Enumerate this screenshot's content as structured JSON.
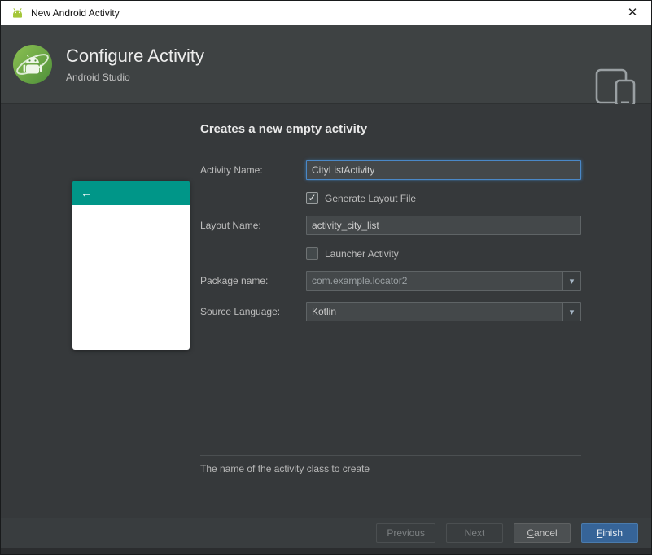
{
  "window": {
    "title": "New Android Activity"
  },
  "icons": {
    "close": "✕",
    "back_arrow": "←",
    "dropdown_arrow": "▾",
    "check": "✓"
  },
  "header": {
    "title": "Configure Activity",
    "subtitle": "Android Studio"
  },
  "form": {
    "heading": "Creates a new empty activity",
    "activity_name": {
      "label": "Activity Name:",
      "value": "CityListActivity"
    },
    "generate_layout_file": {
      "label": "Generate Layout File",
      "checked": true
    },
    "layout_name": {
      "label": "Layout Name:",
      "value": "activity_city_list"
    },
    "launcher_activity": {
      "label": "Launcher Activity",
      "checked": false
    },
    "package_name": {
      "label": "Package name:",
      "value": "com.example.locator2"
    },
    "source_language": {
      "label": "Source Language:",
      "value": "Kotlin"
    },
    "hint": "The name of the activity class to create"
  },
  "buttons": {
    "previous": "Previous",
    "next": "Next",
    "cancel": "Cancel",
    "finish": "Finish"
  },
  "colors": {
    "preview_teal": "#009688",
    "focus_border": "#4a88c7",
    "finish_blue": "#366498",
    "android_green": "#77b255"
  }
}
